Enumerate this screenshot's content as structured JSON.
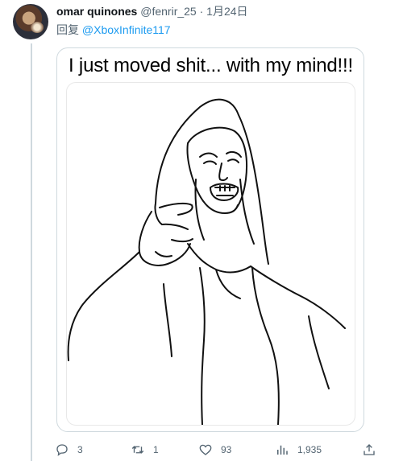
{
  "tweet": {
    "author_name": "omar quinones",
    "author_handle": "@fenrir_25",
    "separator": "·",
    "date": "1月24日",
    "reply_prefix": "回复 ",
    "reply_to": "@XboxInfinite117"
  },
  "media": {
    "caption": "I just moved shit... with my mind!!!"
  },
  "actions": {
    "replies": "3",
    "retweets": "1",
    "likes": "93",
    "views": "1,935"
  },
  "icons": {
    "reply": "speech-bubble-icon",
    "retweet": "retweet-arrows-icon",
    "like": "heart-icon",
    "views": "bar-chart-icon",
    "share": "share-upload-icon"
  },
  "colors": {
    "link": "#1d9bf0",
    "secondary_text": "#536471",
    "border": "#cfd9de"
  }
}
